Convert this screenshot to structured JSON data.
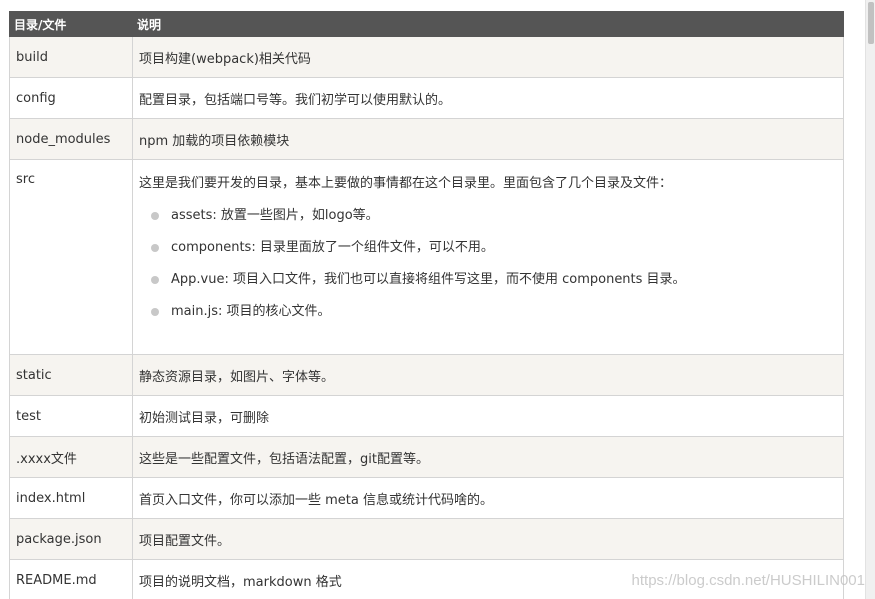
{
  "table": {
    "headers": [
      "目录/文件",
      "说明"
    ],
    "rows": [
      {
        "name": "build",
        "desc": "项目构建(webpack)相关代码"
      },
      {
        "name": "config",
        "desc": "配置目录，包括端口号等。我们初学可以使用默认的。"
      },
      {
        "name": "node_modules",
        "desc": "npm 加载的项目依赖模块"
      },
      {
        "name": "src",
        "desc": "这里是我们要开发的目录，基本上要做的事情都在这个目录里。里面包含了几个目录及文件：",
        "items": [
          "assets: 放置一些图片，如logo等。",
          "components: 目录里面放了一个组件文件，可以不用。",
          "App.vue: 项目入口文件，我们也可以直接将组件写这里，而不使用 components 目录。",
          "main.js: 项目的核心文件。"
        ]
      },
      {
        "name": "static",
        "desc": "静态资源目录，如图片、字体等。"
      },
      {
        "name": "test",
        "desc": "初始测试目录，可删除"
      },
      {
        "name": ".xxxx文件",
        "desc": "这些是一些配置文件，包括语法配置，git配置等。"
      },
      {
        "name": "index.html",
        "desc": "首页入口文件，你可以添加一些 meta 信息或统计代码啥的。"
      },
      {
        "name": "package.json",
        "desc": "项目配置文件。"
      },
      {
        "name": "README.md",
        "desc": "项目的说明文档，markdown 格式"
      }
    ]
  },
  "watermark": "https://blog.csdn.net/HUSHILIN001"
}
